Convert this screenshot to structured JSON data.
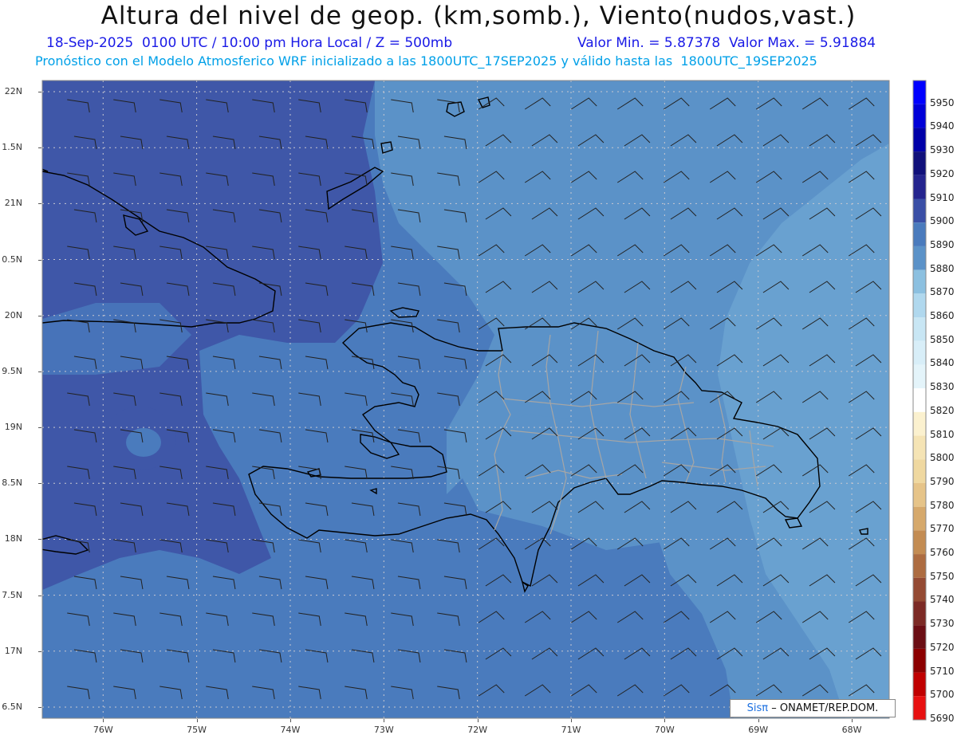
{
  "header": {
    "title": "Altura del nivel de geop. (km,somb.), Viento(nudos,vast.)",
    "line1_left": "18-Sep-2025  0100 UTC / 10:00 pm Hora Local / Z = 500mb",
    "line1_right": "Valor Min. = 5.87378  Valor Max. = 5.91884",
    "line2": "Pronóstico con el Modelo Atmosferico WRF inicializado a las 1800UTC_17SEP2025 y válido hasta las  1800UTC_19SEP2025"
  },
  "map": {
    "lat_ticks": [
      "22N",
      "1.5N",
      "21N",
      "0.5N",
      "20N",
      "9.5N",
      "19N",
      "8.5N",
      "18N",
      "7.5N",
      "17N",
      "6.5N"
    ],
    "lon_ticks": [
      "76W",
      "75W",
      "74W",
      "73W",
      "72W",
      "71W",
      "70W",
      "69W",
      "68W"
    ],
    "lat_values": [
      22,
      21.5,
      21,
      20.5,
      20,
      19.5,
      19,
      18.5,
      18,
      17.5,
      17,
      16.5
    ],
    "lon_values": [
      -76,
      -75,
      -74,
      -73,
      -72,
      -71,
      -70,
      -69,
      -68
    ],
    "extent": {
      "lon_min": -76.65,
      "lon_max": -67.6,
      "lat_min": 16.4,
      "lat_max": 22.1
    },
    "fill_colors": {
      "deep": "#3f57a8",
      "mid": "#4a7bbd",
      "light": "#5b92c8",
      "lighter": "#6ea6d3"
    }
  },
  "colorbar": {
    "labels": [
      "5950",
      "5940",
      "5930",
      "5920",
      "5910",
      "5900",
      "5890",
      "5880",
      "5870",
      "5860",
      "5850",
      "5840",
      "5830",
      "5820",
      "5810",
      "5800",
      "5790",
      "5780",
      "5770",
      "5760",
      "5750",
      "5740",
      "5730",
      "5720",
      "5710",
      "5700",
      "5690"
    ],
    "colors": [
      "#0000ff",
      "#0000d8",
      "#0000a8",
      "#10107a",
      "#24248e",
      "#3a4fa6",
      "#4a7bbd",
      "#5b92c8",
      "#8cc0e0",
      "#b0d8ee",
      "#c8e6f4",
      "#d8eef8",
      "#e4f4fa",
      "#ffffff",
      "#fbf1cf",
      "#f5e4b5",
      "#efd8a0",
      "#e6c489",
      "#d6a96c",
      "#c38c53",
      "#ad6c41",
      "#944a33",
      "#7c2a25",
      "#6b0e14",
      "#8c0000",
      "#c00000",
      "#e81010"
    ]
  },
  "credit": {
    "brand": "Sisπ",
    "text": "– ONAMET/REP.DOM."
  }
}
